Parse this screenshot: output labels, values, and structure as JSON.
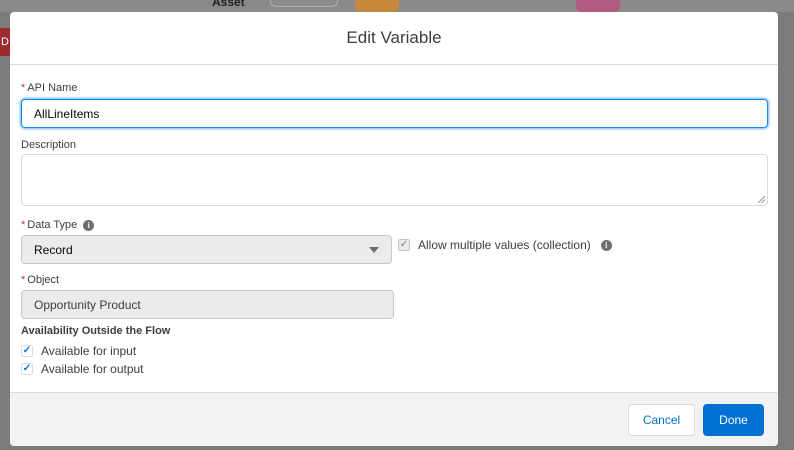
{
  "background": {
    "asset_label": "Asset",
    "side_label": "D"
  },
  "modal": {
    "title": "Edit Variable"
  },
  "form": {
    "required_marker": "*",
    "api_name": {
      "label": "API Name",
      "value": "AllLineItems"
    },
    "description": {
      "label": "Description",
      "value": ""
    },
    "data_type": {
      "label": "Data Type",
      "value": "Record",
      "info_icon": "info-icon"
    },
    "allow_multiple": {
      "label": "Allow multiple values (collection)",
      "checked": true,
      "disabled": true,
      "info_icon": "info-icon"
    },
    "object": {
      "label": "Object",
      "value": "Opportunity Product"
    },
    "availability": {
      "title": "Availability Outside the Flow",
      "options": [
        {
          "label": "Available for input",
          "checked": true
        },
        {
          "label": "Available for output",
          "checked": true
        }
      ]
    }
  },
  "footer": {
    "cancel_label": "Cancel",
    "done_label": "Done"
  },
  "colors": {
    "brand": "#0070d2",
    "required": "#c23934",
    "focus_border": "#1589ee"
  }
}
